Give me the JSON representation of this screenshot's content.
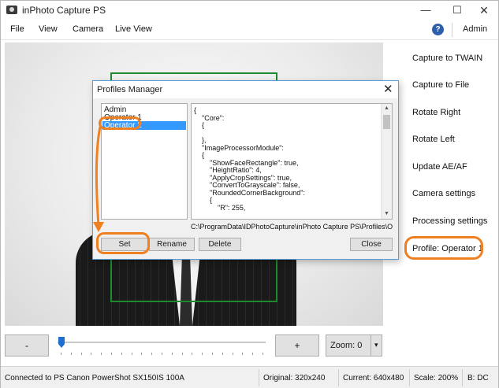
{
  "window": {
    "title": "inPhoto Capture PS",
    "minimize_glyph": "—",
    "maximize_glyph": "☐",
    "close_glyph": "✕",
    "icon": "camera-app-icon"
  },
  "menu": {
    "items": [
      "File",
      "View",
      "Camera",
      "Live View"
    ],
    "help_glyph": "?",
    "admin_label": "Admin"
  },
  "commands": [
    "Capture to TWAIN",
    "Capture to File",
    "Rotate Right",
    "Rotate Left",
    "Update AE/AF",
    "Camera settings",
    "Processing settings",
    "Profile: Operator 1"
  ],
  "zoom": {
    "minus_label": "-",
    "plus_label": "+",
    "zoom_label": "Zoom: 0",
    "zoom_level": 0,
    "slider_level": 0
  },
  "status": {
    "connection": "Connected to PS Canon PowerShot SX150IS 100A",
    "original": "Original: 320x240",
    "current": "Current: 640x480",
    "scale": "Scale: 200%",
    "b": "B: DC"
  },
  "dialog": {
    "title": "Profiles Manager",
    "close_glyph": "✕",
    "profiles": [
      "Admin",
      "Operator 1",
      "Operator 2"
    ],
    "selected_profile": "Operator 2",
    "json_lines": [
      "{",
      "    \"Core\":",
      "    {",
      "",
      "    },",
      "    \"ImageProcessorModule\":",
      "    {",
      "        \"ShowFaceRectangle\": true,",
      "        \"HeightRatio\": 4,",
      "        \"ApplyCropSettings\": true,",
      "        \"ConvertToGrayscale\": false,",
      "        \"RoundedCornerBackground\":",
      "        {",
      "            \"R\": 255,"
    ],
    "path": "C:\\ProgramData\\IDPhotoCapture\\inPhoto Capture PS\\Profiles\\Oper...",
    "buttons": {
      "set": "Set",
      "rename": "Rename",
      "delete": "Delete",
      "close": "Close"
    }
  },
  "colors": {
    "annotation": "#f07f20",
    "crop_frame": "#1e8a2e",
    "selection": "#3399ff",
    "slider": "#1f6fd1"
  }
}
